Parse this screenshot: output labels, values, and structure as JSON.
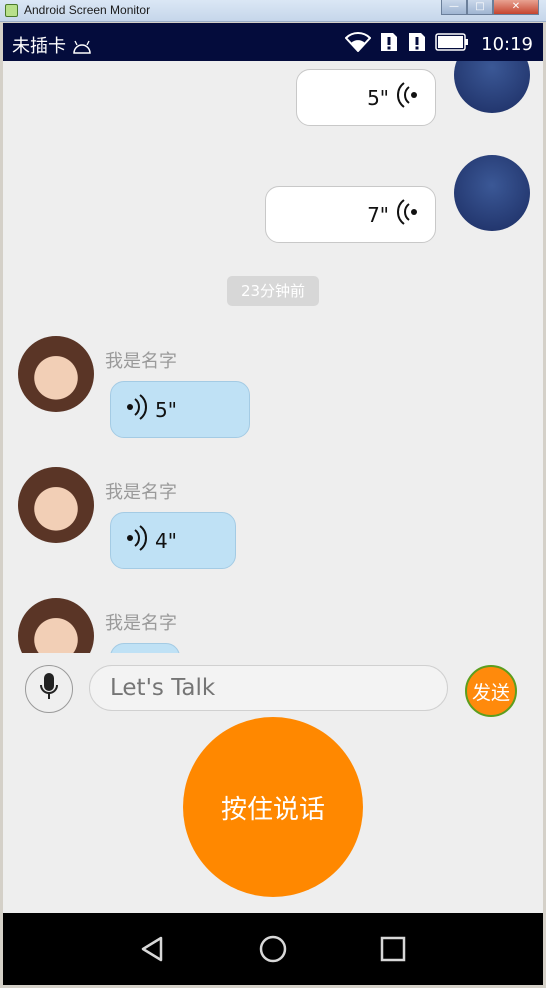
{
  "window": {
    "title": "Android Screen Monitor",
    "min": "—",
    "max": "□",
    "close": "✕"
  },
  "statusbar": {
    "carrier": "未插卡",
    "time": "10:19"
  },
  "messages_out": [
    {
      "duration": "5\""
    },
    {
      "duration": "7\""
    }
  ],
  "time_divider": "23分钟前",
  "messages_in": [
    {
      "name": "我是名字",
      "duration": "5\""
    },
    {
      "name": "我是名字",
      "duration": "4\""
    },
    {
      "name": "我是名字",
      "duration": ""
    }
  ],
  "input": {
    "placeholder": "Let's Talk",
    "send_label": "发送",
    "talk_label": "按住说话"
  },
  "colors": {
    "accent": "#ff8800",
    "incoming_bubble": "#bfe1f5",
    "status_bar": "#040c3c"
  }
}
